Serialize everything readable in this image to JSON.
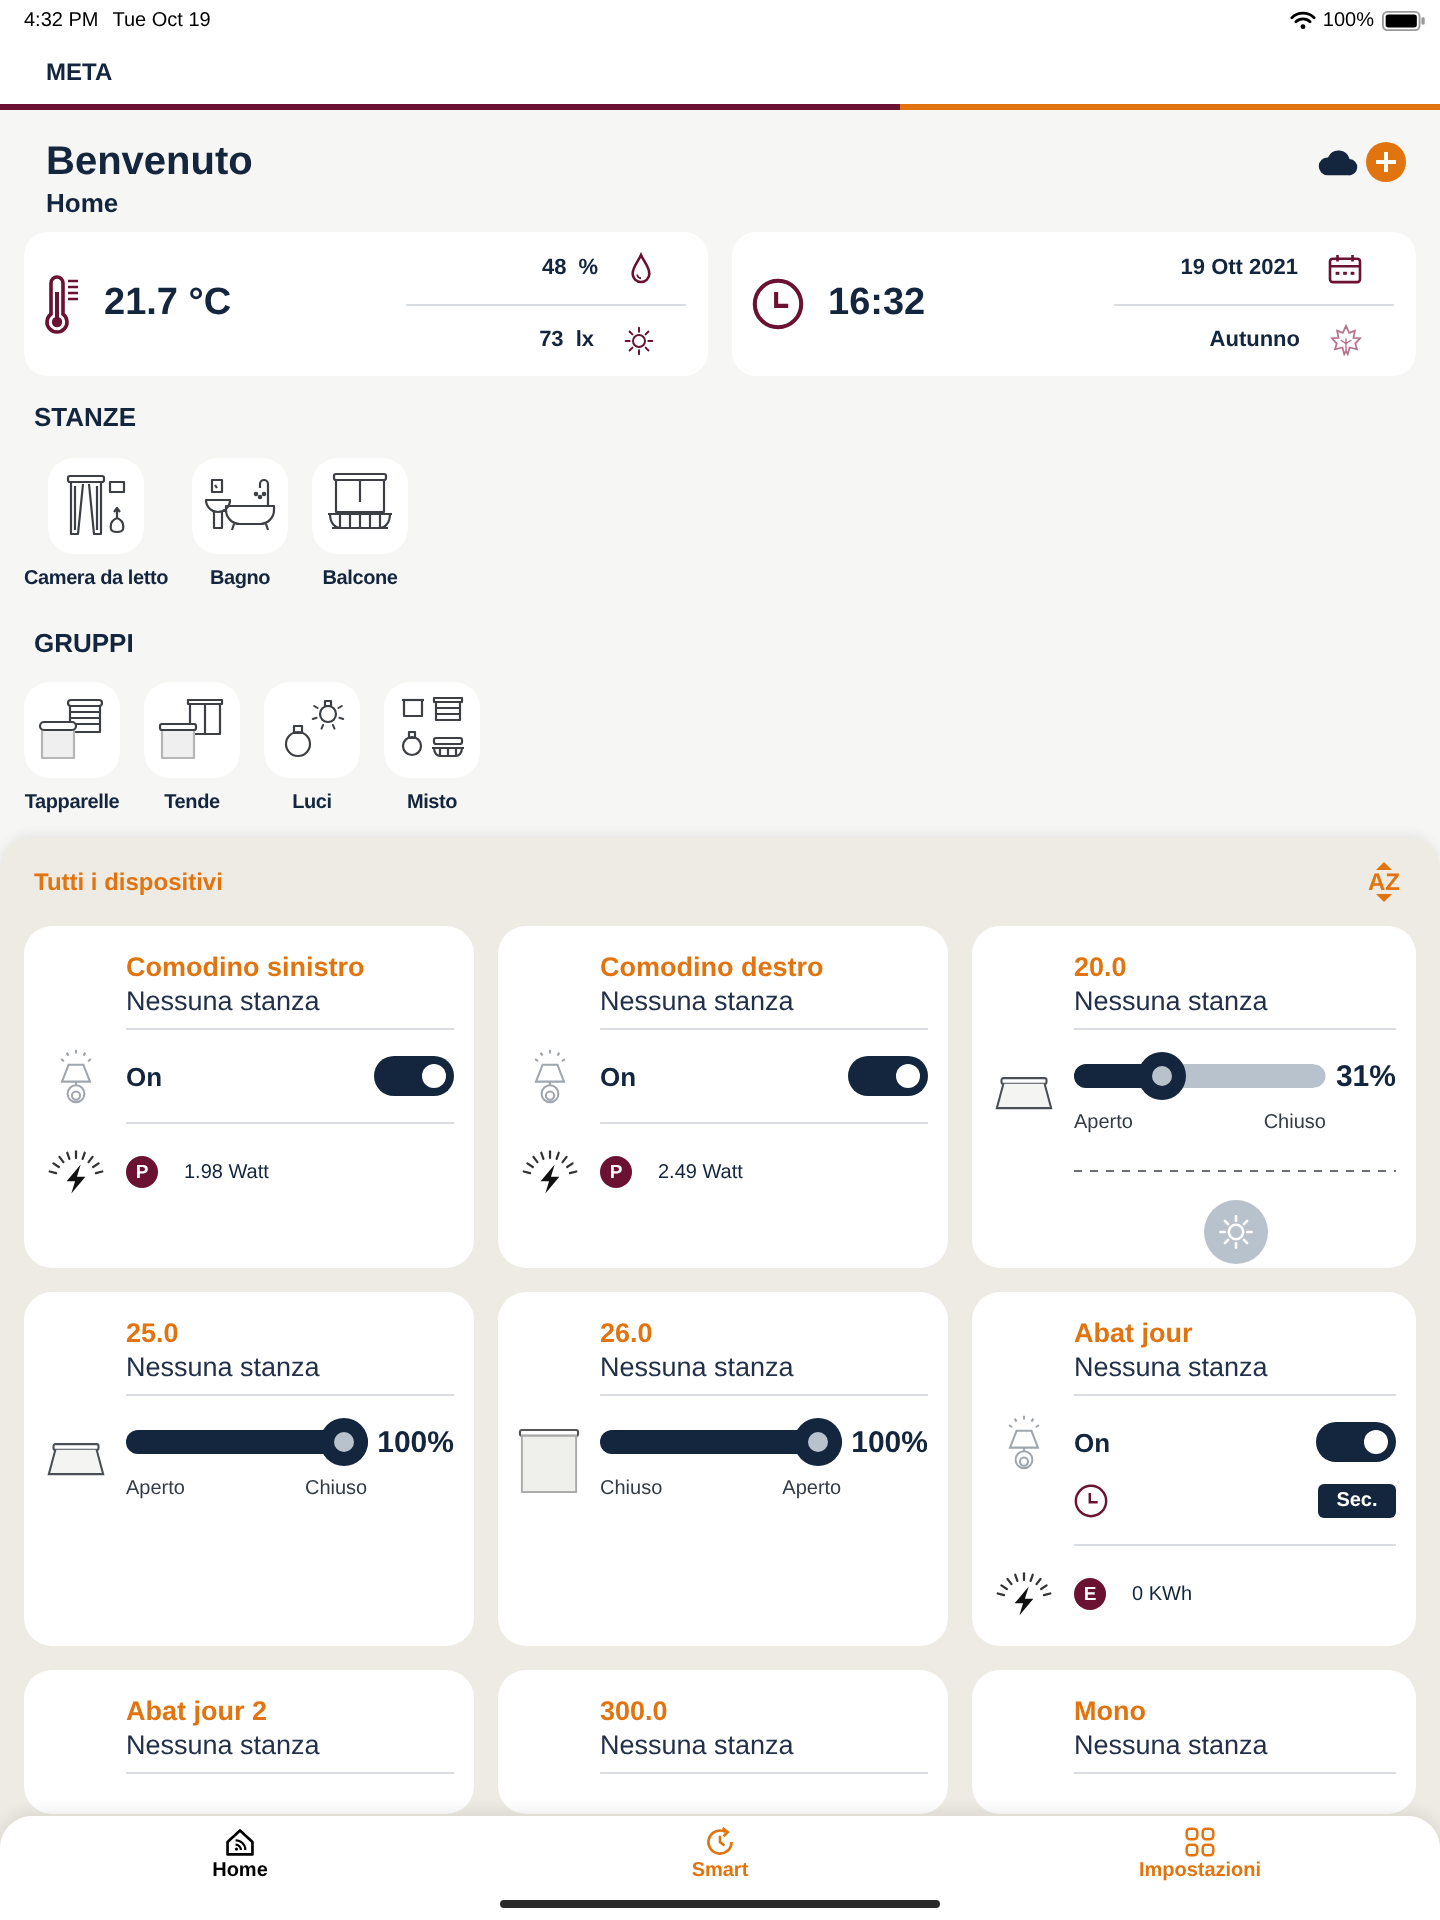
{
  "status_bar": {
    "time": "4:32 PM",
    "date": "Tue Oct 19",
    "battery": "100%"
  },
  "nav_bar": {
    "title": "META"
  },
  "progress_bar": {
    "level": 0.625
  },
  "header": {
    "title": "Benvenuto",
    "subtitle": "Home",
    "actions": [
      {
        "kind": "cloud"
      },
      {
        "kind": "add"
      }
    ]
  },
  "info_cards": [
    {
      "kind": "climate",
      "value": "21.7 °C",
      "rows": [
        {
          "kind": "humidity",
          "value": "48",
          "unit": "%"
        },
        {
          "kind": "light",
          "value": "73",
          "unit": "lx"
        }
      ]
    },
    {
      "kind": "clock",
      "value": "16:32",
      "rows": [
        {
          "kind": "date",
          "value": "19 Ott 2021"
        },
        {
          "kind": "season",
          "value": "Autunno"
        }
      ]
    }
  ],
  "rooms": {
    "title": "STANZE",
    "items": [
      {
        "kind": "bedroom",
        "label": "Camera da letto"
      },
      {
        "kind": "bathroom",
        "label": "Bagno"
      },
      {
        "kind": "balcony",
        "label": "Balcone"
      }
    ]
  },
  "groups": {
    "title": "GRUPPI",
    "items": [
      {
        "kind": "shutters",
        "label": "Tapparelle"
      },
      {
        "kind": "curtains",
        "label": "Tende"
      },
      {
        "kind": "lights",
        "label": "Luci"
      },
      {
        "kind": "mixed",
        "label": "Misto"
      }
    ]
  },
  "devices": {
    "title": "Tutti i dispositivi",
    "sort": "AZ",
    "items": [
      {
        "kind": "light",
        "name": "Comodino sinistro",
        "room": "Nessuna stanza",
        "state": "On",
        "on": true,
        "meter": {
          "badge": "P",
          "reading": "1.98 Watt"
        }
      },
      {
        "kind": "light",
        "name": "Comodino destro",
        "room": "Nessuna stanza",
        "state": "On",
        "on": true,
        "meter": {
          "badge": "P",
          "reading": "2.49 Watt"
        }
      },
      {
        "kind": "awning",
        "name": "20.0",
        "room": "Nessuna stanza",
        "level": 0.31,
        "reading": "31%",
        "labels": [
          "Aperto",
          "Chiuso"
        ],
        "sun_control": true
      },
      {
        "kind": "awning",
        "name": "25.0",
        "room": "Nessuna stanza",
        "level": 1,
        "reading": "100%",
        "labels": [
          "Aperto",
          "Chiuso"
        ],
        "sun_control": false
      },
      {
        "kind": "blind",
        "name": "26.0",
        "room": "Nessuna stanza",
        "level": 1,
        "reading": "100%",
        "labels": [
          "Chiuso",
          "Aperto"
        ],
        "sun_control": false
      },
      {
        "kind": "light",
        "name": "Abat jour",
        "room": "Nessuna stanza",
        "state": "On",
        "on": true,
        "timer": {
          "button": "Sec."
        },
        "meter": {
          "badge": "E",
          "reading": "0 KWh"
        }
      },
      {
        "kind": "partial",
        "name": "Abat jour 2",
        "room": "Nessuna stanza"
      },
      {
        "kind": "partial",
        "name": "300.0",
        "room": "Nessuna stanza"
      },
      {
        "kind": "partial",
        "name": "Mono",
        "room": "Nessuna stanza"
      }
    ]
  },
  "tabs": {
    "items": [
      {
        "kind": "home",
        "label": "Home",
        "selected": true
      },
      {
        "kind": "smart",
        "label": "Smart",
        "selected": false
      },
      {
        "kind": "settings",
        "label": "Impostazioni",
        "selected": false
      }
    ]
  }
}
